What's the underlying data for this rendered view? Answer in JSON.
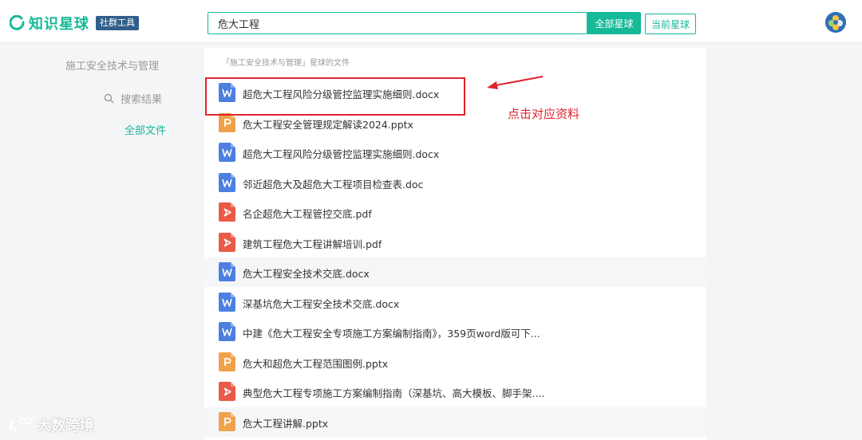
{
  "header": {
    "logo_text": "知识星球",
    "logo_badge": "社群工具",
    "search_value": "危大工程",
    "btn_all": "全部星球",
    "btn_current": "当前星球"
  },
  "sidebar": {
    "title": "施工安全技术与管理",
    "search_results": "搜索结果",
    "all_files": "全部文件"
  },
  "panel": {
    "head": "「施工安全技术与管理」星球的文件"
  },
  "files": [
    {
      "name": "超危大工程风险分级管控监理实施细则.docx",
      "type": "word"
    },
    {
      "name": "危大工程安全管理规定解读2024.pptx",
      "type": "ppt"
    },
    {
      "name": "超危大工程风险分级管控监理实施细则.docx",
      "type": "word"
    },
    {
      "name": "邻近超危大及超危大工程项目检查表.doc",
      "type": "word"
    },
    {
      "name": "名企超危大工程管控交底.pdf",
      "type": "pdf"
    },
    {
      "name": "建筑工程危大工程讲解培训.pdf",
      "type": "pdf"
    },
    {
      "name": "危大工程安全技术交底.docx",
      "type": "word"
    },
    {
      "name": "深基坑危大工程安全技术交底.docx",
      "type": "word"
    },
    {
      "name": "中建《危大工程安全专项施工方案编制指南》，359页word版可下...",
      "type": "word"
    },
    {
      "name": "危大和超危大工程范围图例.pptx",
      "type": "ppt"
    },
    {
      "name": "典型危大工程专项施工方案编制指南（深基坑、高大模板、脚手架....",
      "type": "pdf"
    },
    {
      "name": "危大工程讲解.pptx",
      "type": "ppt"
    }
  ],
  "annotation": {
    "text": "点击对应资料",
    "color": "#e0232d"
  },
  "watermark": "大数跨境",
  "colors": {
    "accent": "#16b998",
    "word": "#4d7fe0",
    "ppt": "#f0a14b",
    "pdf": "#ea5a47"
  }
}
